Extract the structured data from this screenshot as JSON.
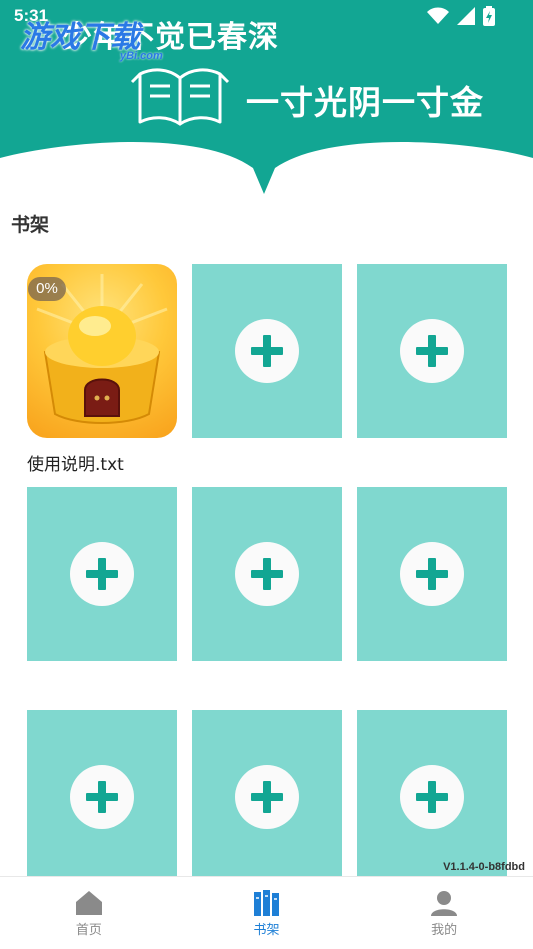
{
  "status_bar": {
    "time": "5:31"
  },
  "banner": {
    "slogan_top": "少年不觉已春深",
    "slogan_main": "一寸光阴一寸金",
    "watermark": "游戏下载",
    "watermark_sub": "yBi.com",
    "bg_color": "#12a693"
  },
  "bookshelf": {
    "title": "书架",
    "books": [
      {
        "title": "使用说明.txt",
        "progress": "0%"
      }
    ],
    "empty_slots": 8,
    "slot_color": "#80d8cf",
    "plus_color": "#12a693"
  },
  "version": "V1.1.4-0-b8fdbd",
  "nav": {
    "items": [
      {
        "label": "首页",
        "icon": "home-icon",
        "active": false
      },
      {
        "label": "书架",
        "icon": "bookshelf-icon",
        "active": true
      },
      {
        "label": "我的",
        "icon": "profile-icon",
        "active": false
      }
    ],
    "active_color": "#1e7fd6",
    "inactive_color": "#8a8a8a"
  }
}
